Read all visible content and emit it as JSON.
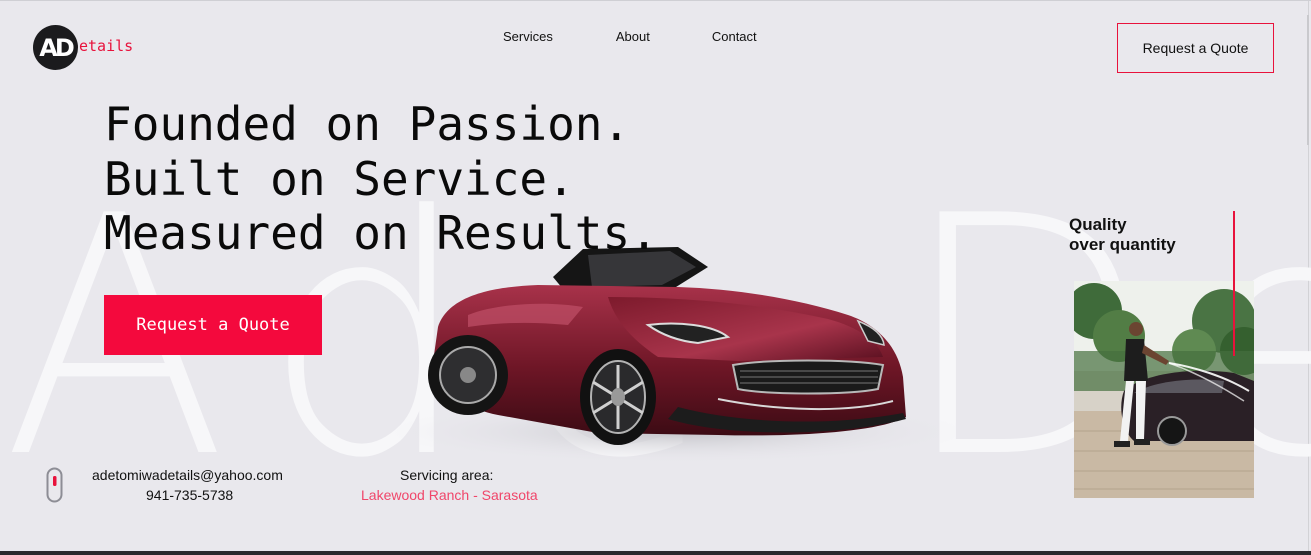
{
  "brand": {
    "logo_mark": "AD",
    "logo_text": "etails"
  },
  "nav": {
    "services": "Services",
    "about": "About",
    "contact": "Contact"
  },
  "header": {
    "quote_button": "Request a Quote"
  },
  "hero": {
    "line1": "Founded on Passion.",
    "line2": "Built on Service.",
    "line3": "Measured on Results.",
    "cta": "Request a Quote",
    "watermark": "Ade  De"
  },
  "contact": {
    "email": "adetomiwadetails@yahoo.com",
    "phone": "941-735-5738",
    "icon": "phone-icon"
  },
  "service_area": {
    "label": "Servicing area:",
    "value": "Lakewood Ranch - Sarasota"
  },
  "side": {
    "quality_line1": "Quality",
    "quality_line2": "over quantity"
  },
  "colors": {
    "accent": "#e8123c",
    "cta_bg": "#f4093d",
    "background": "#e9e8ed",
    "area_text": "#f0466a"
  }
}
